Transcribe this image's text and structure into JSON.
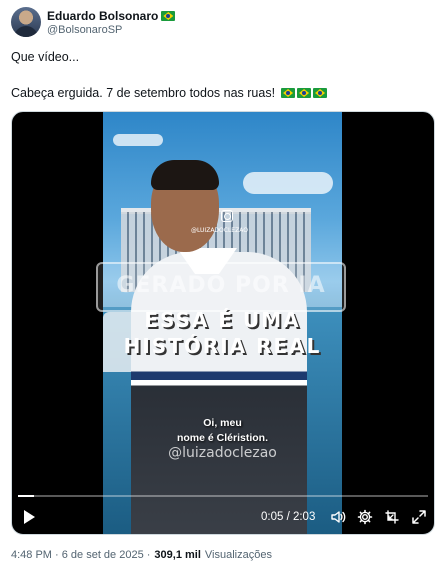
{
  "author": {
    "display_name": "Eduardo Bolsonaro",
    "handle": "@BolsonaroSP"
  },
  "tweet": {
    "line1": "Que vídeo...",
    "line2": "Cabeça erguida. 7 de setembro todos nas ruas!"
  },
  "video": {
    "instagram_handle": "@LUIZADOCLEZAO",
    "watermark": "GERADO POR IA",
    "headline_line1": "ESSA É UMA",
    "headline_line2": "HISTÓRIA REAL",
    "subtitle_line1": "Oi, meu",
    "subtitle_line2": "nome é Cléristion.",
    "tiktok_handle": "@luizadoclezao",
    "time": "0:05 / 2:03",
    "progress_fraction": 0.04
  },
  "footer": {
    "timestamp": "4:48 PM · 6 de set de 2025 ·",
    "views_count": "309,1 mil",
    "views_label": "Visualizações"
  },
  "colors": {
    "text_primary": "#0f1419",
    "text_secondary": "#536471",
    "flag_green": "#1a9b3c",
    "flag_yellow": "#f3d000",
    "flag_blue": "#1c3f94"
  },
  "icons": [
    "brazil-flag-icon",
    "instagram-icon",
    "play-icon",
    "volume-icon",
    "settings-gear-icon",
    "picture-in-picture-icon",
    "fullscreen-icon"
  ]
}
